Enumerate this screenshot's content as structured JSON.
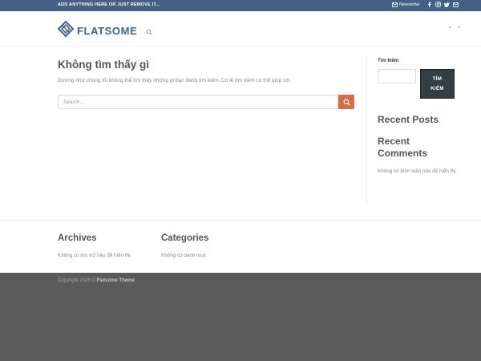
{
  "topbar": {
    "promo": "ADD ANYTHING HERE OR JUST REMOVE IT...",
    "newsletter": "Newsletter",
    "social_icons": [
      "facebook-icon",
      "instagram-icon",
      "twitter-icon",
      "email-icon"
    ]
  },
  "header": {
    "logo_text": "FLATSOME",
    "search_icon": "search-icon"
  },
  "main": {
    "title": "Không tìm thấy gì",
    "description": "Dường như chúng tôi không thể tìm thấy những gì bạn đang tìm kiếm. Có lẽ tìm kiếm có thể giúp ích.",
    "search_placeholder": "Search..."
  },
  "sidebar": {
    "search_label": "Tìm kiếm",
    "search_button_line1": "TÌM",
    "search_button_line2": "KIẾM",
    "recent_posts_title": "Recent Posts",
    "recent_comments_title": "Recent Comments",
    "recent_comments_text": "Không có bình luận nào để hiển thị."
  },
  "footer_widgets": {
    "archives_title": "Archives",
    "archives_text": "Không có lưu trữ nào để hiển thị.",
    "categories_title": "Categories",
    "categories_text": "Không có danh mục"
  },
  "footer": {
    "copyright_prefix": "Copyright 2025 ©",
    "copyright_brand": "Flatsome Theme"
  },
  "colors": {
    "topbar": "#446084",
    "accent": "#d26e4b",
    "footer": "#5b5b5b",
    "button_dark": "#333d42"
  }
}
